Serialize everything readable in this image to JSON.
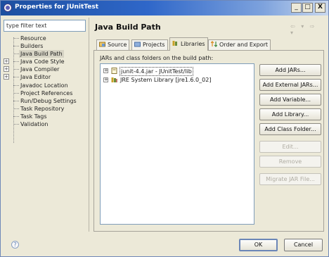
{
  "window": {
    "title": "Properties for JUnitTest",
    "minimize_glyph": "_",
    "maximize_glyph": "□",
    "close_glyph": "X"
  },
  "filter": {
    "placeholder": "type filter text",
    "value": "type filter text"
  },
  "nav": {
    "items": [
      {
        "label": "Resource",
        "expandable": false
      },
      {
        "label": "Builders",
        "expandable": false
      },
      {
        "label": "Java Build Path",
        "expandable": false,
        "selected": true
      },
      {
        "label": "Java Code Style",
        "expandable": true
      },
      {
        "label": "Java Compiler",
        "expandable": true
      },
      {
        "label": "Java Editor",
        "expandable": true
      },
      {
        "label": "Javadoc Location",
        "expandable": false
      },
      {
        "label": "Project References",
        "expandable": false
      },
      {
        "label": "Run/Debug Settings",
        "expandable": false
      },
      {
        "label": "Task Repository",
        "expandable": false
      },
      {
        "label": "Task Tags",
        "expandable": false
      },
      {
        "label": "Validation",
        "expandable": false
      }
    ],
    "expand_glyph": "+"
  },
  "page": {
    "title": "Java Build Path",
    "nav_arrows": "⇦ ▾ ⇨ ▾"
  },
  "tabs": [
    {
      "label": "Source",
      "icon": "source-folder-icon"
    },
    {
      "label": "Projects",
      "icon": "projects-icon"
    },
    {
      "label": "Libraries",
      "icon": "libraries-icon",
      "active": true
    },
    {
      "label": "Order and Export",
      "icon": "order-export-icon"
    }
  ],
  "libraries": {
    "section_label": "JARs and class folders on the build path:",
    "entries": [
      {
        "label": "junit-4.4.jar - JUnitTest/lib",
        "icon": "jar-icon",
        "selected": true
      },
      {
        "label": "JRE System Library [jre1.6.0_02]",
        "icon": "library-icon",
        "selected": false
      }
    ],
    "expand_glyph": "+"
  },
  "buttons": {
    "add_jars": "Add JARs...",
    "add_external_jars": "Add External JARs...",
    "add_variable": "Add Variable...",
    "add_library": "Add Library...",
    "add_class_folder": "Add Class Folder...",
    "edit": "Edit...",
    "remove": "Remove",
    "migrate_jar": "Migrate JAR File..."
  },
  "footer": {
    "help_glyph": "?",
    "ok": "OK",
    "cancel": "Cancel"
  },
  "colors": {
    "title_bar": "#2f67c9",
    "dialog_bg": "#ece9d8",
    "selection": "#d6d3c4"
  }
}
